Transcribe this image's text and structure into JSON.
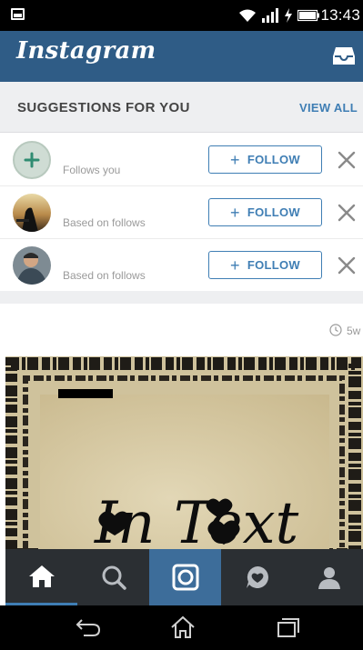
{
  "status_bar": {
    "time": "13:43"
  },
  "header": {
    "title": "Instagram"
  },
  "suggestions": {
    "title": "SUGGESTIONS FOR YOU",
    "view_all": "VIEW ALL",
    "items": [
      {
        "reason": "Follows you",
        "follow_label": "FOLLOW"
      },
      {
        "reason": "Based on follows",
        "follow_label": "FOLLOW"
      },
      {
        "reason": "Based on follows",
        "follow_label": "FOLLOW"
      }
    ]
  },
  "post": {
    "age": "5w",
    "image_text": "In Text"
  },
  "icons": {
    "status": [
      "screenshot-icon",
      "wifi-icon",
      "signal-icon",
      "charging-icon",
      "battery-icon"
    ],
    "header": "inbox-icon",
    "nav": [
      "home-icon",
      "search-icon",
      "camera-icon",
      "activity-icon",
      "profile-icon"
    ],
    "system": [
      "back-icon",
      "home-system-icon",
      "recents-icon"
    ]
  },
  "colors": {
    "header": "#2f5c86",
    "accent": "#3f7eb4",
    "nav_background": "#2b2f33",
    "camera_tab": "#3d6d9a"
  }
}
